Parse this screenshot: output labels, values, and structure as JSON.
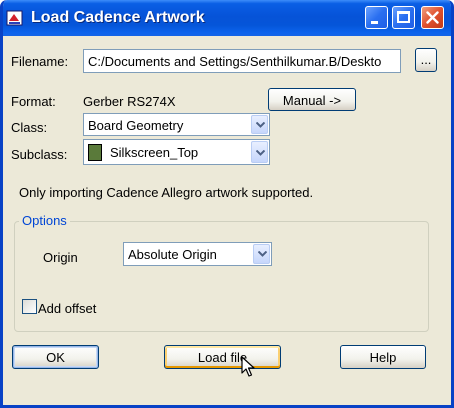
{
  "window": {
    "title": "Load Cadence Artwork"
  },
  "filename": {
    "label": "Filename:",
    "value": "C:/Documents and Settings/Senthilkumar.B/Deskto",
    "browse_label": "..."
  },
  "format": {
    "label": "Format:",
    "value": "Gerber RS274X",
    "manual_label": "Manual ->"
  },
  "class": {
    "label": "Class:",
    "value": "Board Geometry"
  },
  "subclass": {
    "label": "Subclass:",
    "value": "Silkscreen_Top",
    "swatch_color": "#5a7a3a"
  },
  "info_text": "Only importing Cadence Allegro artwork supported.",
  "options": {
    "legend": "Options",
    "origin_label": "Origin",
    "origin_value": "Absolute Origin",
    "add_offset_label": "Add offset",
    "add_offset_checked": false
  },
  "buttons": {
    "ok": "OK",
    "load": "Load file",
    "help": "Help"
  },
  "colors": {
    "title_bar": "#0653d8",
    "window_bg": "#ece9d8",
    "legend_text": "#0046d5"
  }
}
